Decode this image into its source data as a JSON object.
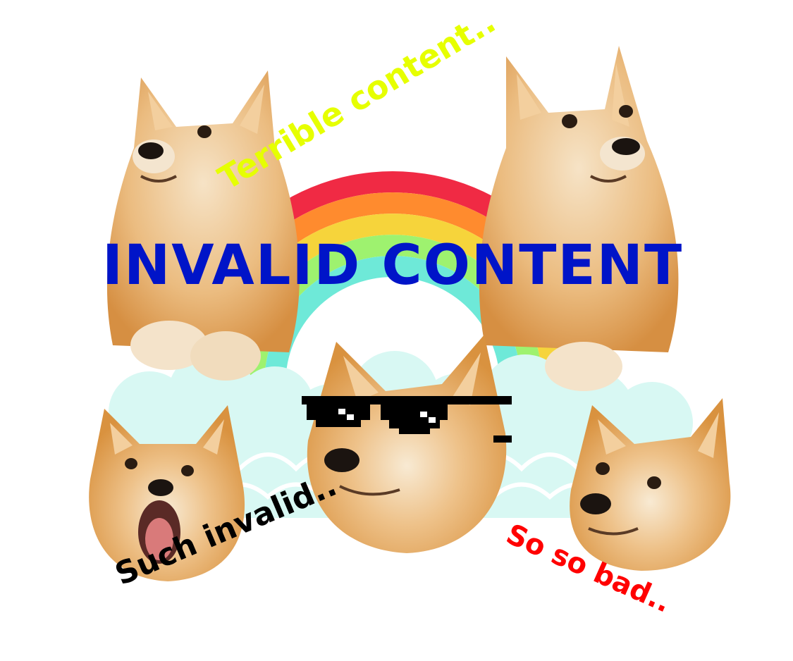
{
  "title": "INVALID CONTENT",
  "captions": {
    "terrible": "Terrible content..",
    "such": "Such invalid..",
    "bad": "So so bad.."
  },
  "colors": {
    "title": "#0014c8",
    "terrible": "#e6ff00",
    "such": "#000000",
    "bad": "#ff0000",
    "rainbow": [
      "#f02a44",
      "#ff8b2e",
      "#f6d43b",
      "#9ef26f",
      "#6ee9d8"
    ],
    "cloud": "#d8f8f3",
    "fur": "#e3a55f",
    "cream": "#f6e6cb"
  },
  "icons": [
    "rainbow-icon",
    "cloud-icon",
    "doge-icon",
    "pixel-sunglasses-icon"
  ]
}
